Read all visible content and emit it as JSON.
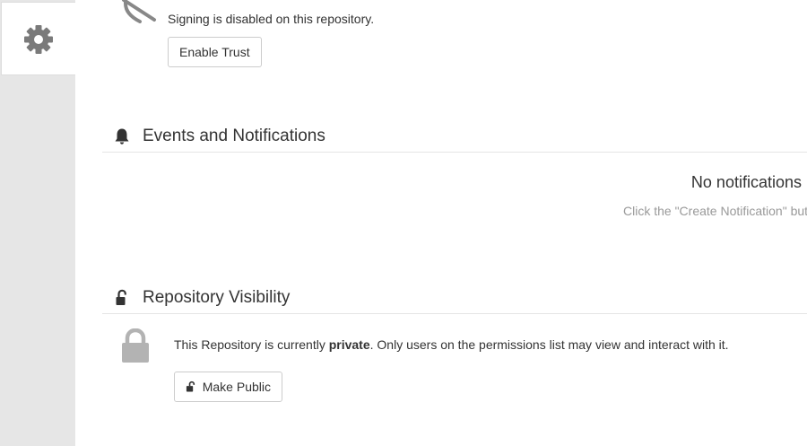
{
  "sidebar": {
    "active_tab_icon": "gear-icon"
  },
  "signing": {
    "icon": "shield-slash-icon",
    "text": "Signing is disabled on this repository.",
    "button_label": "Enable Trust"
  },
  "events": {
    "icon": "bell-icon",
    "title": "Events and Notifications",
    "empty_title": "No notifications",
    "empty_hint": "Click the \"Create Notification\" but"
  },
  "visibility": {
    "icon": "unlock-icon",
    "title": "Repository Visibility",
    "status_icon": "lock-icon",
    "text_prefix": "This Repository is currently ",
    "text_status": "private",
    "text_suffix": ". Only users on the permissions list may view and interact with it.",
    "button_label": "Make Public"
  },
  "colors": {
    "sidebar_bg": "#e6e6e6",
    "icon_gray": "#777777",
    "lock_gray": "#aaaaaa",
    "hint_gray": "#999999"
  }
}
